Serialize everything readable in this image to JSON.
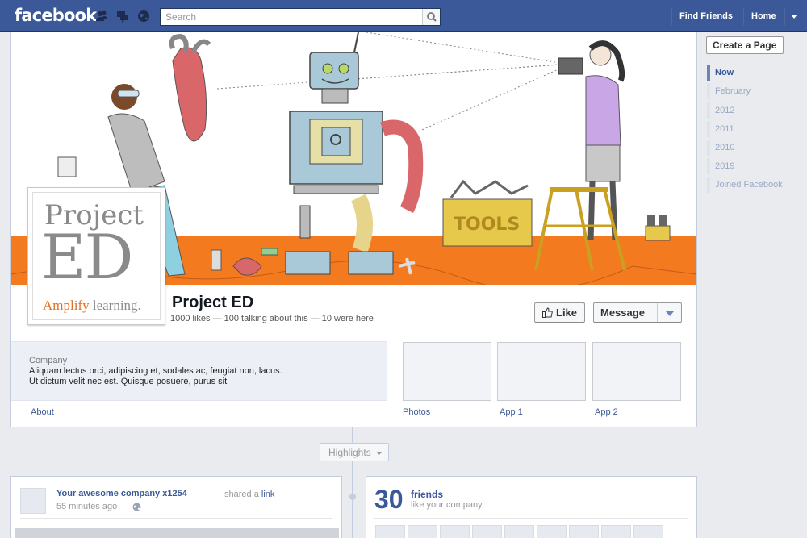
{
  "topbar": {
    "logo": "facebook",
    "search_placeholder": "Search",
    "find_friends": "Find Friends",
    "home": "Home"
  },
  "page": {
    "name": "Project ED",
    "stats": "1000 likes — 100 talking about this — 10 were here",
    "logo_line1": "Project",
    "logo_line2": "ED",
    "logo_tagline_1": "Amplify",
    "logo_tagline_2": " learning.",
    "cover_sign": "TOOLS"
  },
  "actions": {
    "like": "Like",
    "message": "Message"
  },
  "about": {
    "category": "Company",
    "text": "Aliquam lectus orci, adipiscing et, sodales ac, feugiat non, lacus. Ut dictum velit nec est. Quisque posuere, purus sit",
    "link": "About"
  },
  "apps": [
    {
      "label": "Photos"
    },
    {
      "label": "App 1"
    },
    {
      "label": "App 2"
    }
  ],
  "highlights": "Highlights",
  "story": {
    "author": "Your awesome company x1254",
    "action": "shared a",
    "action_link": "link",
    "time": "55 minutes ago"
  },
  "friends": {
    "count": "30",
    "label": "friends",
    "sub": "like your company"
  },
  "right_rail": {
    "create_page": "Create a Page",
    "scrubber": [
      "Now",
      "February",
      "2012",
      "2011",
      "2010",
      "2019",
      "Joined Facebook"
    ]
  },
  "colors": {
    "brand": "#3b5998",
    "cover_floor": "#f47a20",
    "logo_accent": "#e36f1e"
  }
}
